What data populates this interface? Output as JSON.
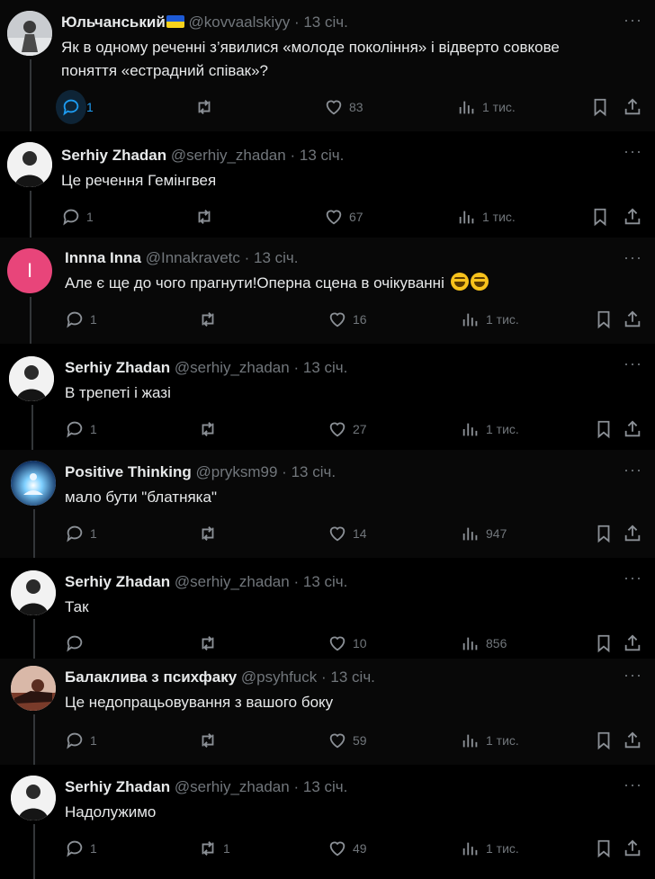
{
  "colors": {
    "background": "#000000",
    "text_primary": "#e7e9ea",
    "text_secondary": "#71767b",
    "accent_blue": "#1d9bf0",
    "thread_line": "#333639"
  },
  "more_label": "···",
  "tweets": [
    {
      "name": "Юльчанський",
      "has_flag": true,
      "handle": "@kovvaalskiyy",
      "time": "13 січ.",
      "text": "Як в одному реченні з’явилися «молоде покоління» і відверто совкове поняття «естрадний співак»?",
      "replies": "1",
      "retweets": "",
      "likes": "83",
      "views": "1 тис.",
      "avatar": "user-photo"
    },
    {
      "name": "Serhiy Zhadan",
      "handle": "@serhiy_zhadan",
      "time": "13 січ.",
      "text": "Це речення Гемінгвея",
      "replies": "1",
      "retweets": "",
      "likes": "67",
      "views": "1 тис.",
      "avatar": "zhadan"
    },
    {
      "name": "Innna Inna",
      "handle": "@Innakravetc",
      "time": "13 січ.",
      "text": "Але є ще до чого прагнути!Оперна сцена в очікуванні",
      "emojis": 2,
      "replies": "1",
      "retweets": "",
      "likes": "16",
      "views": "1 тис.",
      "avatar": "letter",
      "avatar_letter": "I",
      "avatar_color": "#e8457a"
    },
    {
      "name": "Serhiy Zhadan",
      "handle": "@serhiy_zhadan",
      "time": "13 січ.",
      "text": "В трепеті і жазі",
      "replies": "1",
      "retweets": "",
      "likes": "27",
      "views": "1 тис.",
      "avatar": "zhadan"
    },
    {
      "name": "Positive Thinking",
      "handle": "@pryksm99",
      "time": "13 січ.",
      "text": "мало бути \"блатняка\"",
      "replies": "1",
      "retweets": "",
      "likes": "14",
      "views": "947",
      "avatar": "meditation"
    },
    {
      "name": "Serhiy Zhadan",
      "handle": "@serhiy_zhadan",
      "time": "13 січ.",
      "text": "Так",
      "replies": "",
      "retweets": "",
      "likes": "10",
      "views": "856",
      "avatar": "zhadan"
    },
    {
      "name": "Балаклива з психфаку",
      "handle": "@psyhfuck",
      "time": "13 січ.",
      "text": "Це недопрацьовування з вашого боку",
      "replies": "1",
      "retweets": "",
      "likes": "59",
      "views": "1 тис.",
      "avatar": "photo-warm"
    },
    {
      "name": "Serhiy Zhadan",
      "handle": "@serhiy_zhadan",
      "time": "13 січ.",
      "text": "Надолужимо",
      "replies": "1",
      "retweets": "1",
      "likes": "49",
      "views": "1 тис.",
      "avatar": "zhadan"
    }
  ]
}
